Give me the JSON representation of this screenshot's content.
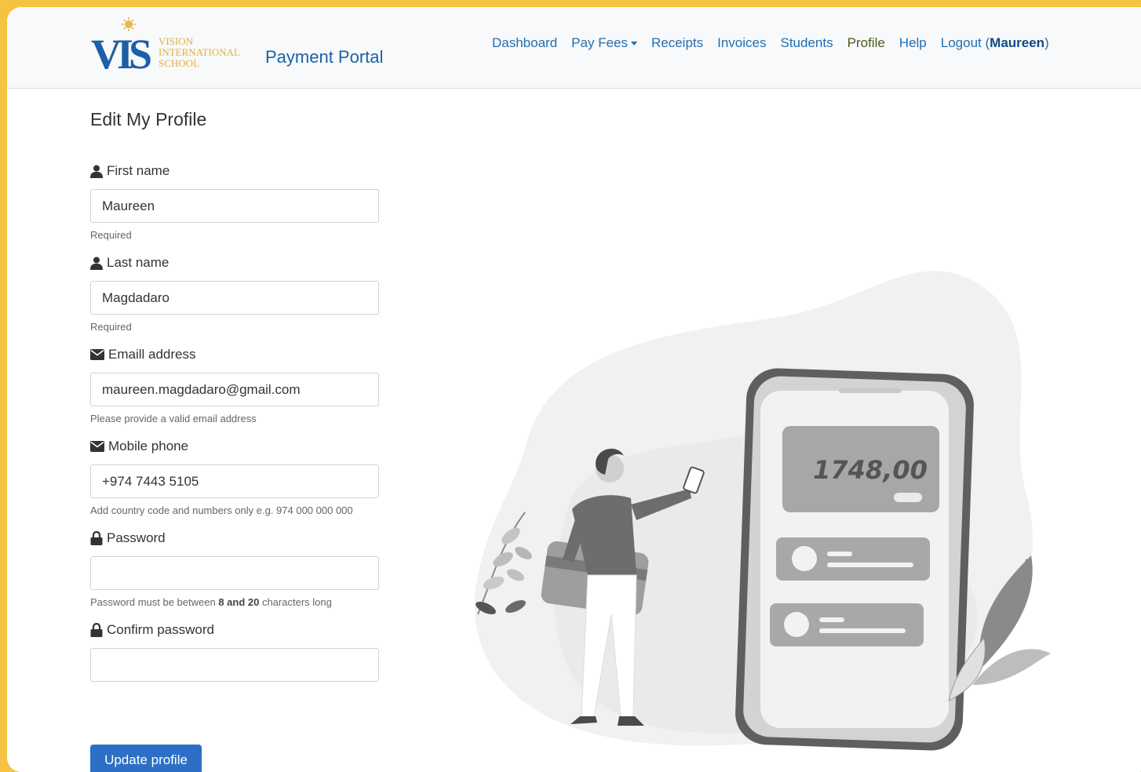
{
  "brand": {
    "logo_letters": "VIS",
    "logo_line1": "VISION",
    "logo_line2": "INTERNATIONAL",
    "logo_line3": "SCHOOL",
    "portal_title": "Payment Portal"
  },
  "nav": {
    "items": [
      {
        "label": "Dashboard"
      },
      {
        "label": "Pay Fees"
      },
      {
        "label": "Receipts"
      },
      {
        "label": "Invoices"
      },
      {
        "label": "Students"
      },
      {
        "label": "Profile"
      },
      {
        "label": "Help"
      }
    ],
    "logout_label": "Logout (",
    "logout_user": "Maureen",
    "logout_close": ")"
  },
  "page": {
    "title": "Edit My Profile"
  },
  "form": {
    "first_name": {
      "label": "First name",
      "value": "Maureen",
      "help": "Required"
    },
    "last_name": {
      "label": "Last name",
      "value": "Magdadaro",
      "help": "Required"
    },
    "email": {
      "label": "Emaill address",
      "value": "maureen.magdadaro@gmail.com",
      "help": "Please provide a valid email address"
    },
    "mobile": {
      "label": "Mobile phone",
      "value": "+974 7443 5105",
      "help": "Add country code and numbers only e.g. 974 000 000 000"
    },
    "password": {
      "label": "Password",
      "value": "",
      "help_prefix": "Password must be between ",
      "help_bold": "8 and 20",
      "help_suffix": " characters long"
    },
    "confirm_password": {
      "label": "Confirm password",
      "value": ""
    },
    "submit_label": "Update profile"
  },
  "illustration": {
    "phone_amount": "1748,00"
  },
  "colors": {
    "accent": "#2d6fc6",
    "nav_link": "#1f6fb2",
    "frame": "#f5c242"
  }
}
